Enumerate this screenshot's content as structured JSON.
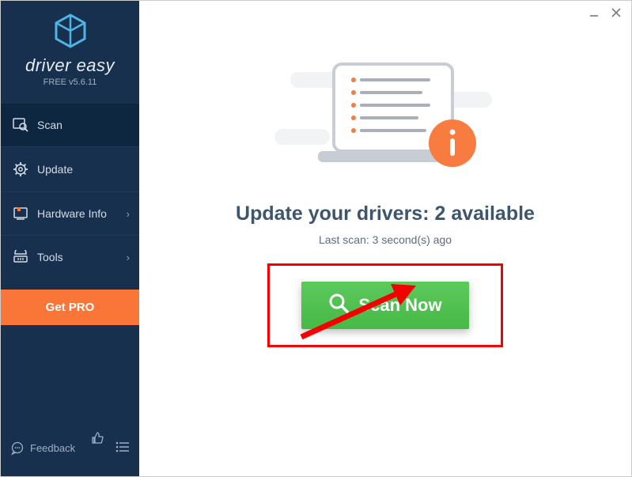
{
  "app": {
    "name": "driver easy",
    "version": "FREE v5.6.11"
  },
  "sidebar": {
    "items": [
      {
        "label": "Scan"
      },
      {
        "label": "Update"
      },
      {
        "label": "Hardware Info"
      },
      {
        "label": "Tools"
      }
    ],
    "get_pro": "Get PRO",
    "feedback": "Feedback"
  },
  "main": {
    "headline": "Update your drivers: 2 available",
    "last_scan": "Last scan: 3 second(s) ago",
    "scan_button": "Scan Now"
  }
}
